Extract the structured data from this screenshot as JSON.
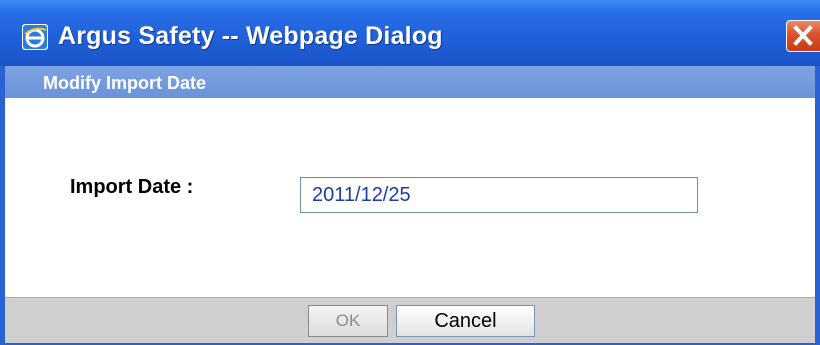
{
  "window": {
    "title": "Argus Safety -- Webpage Dialog",
    "icon": "internet-explorer-icon",
    "close_icon": "close-icon",
    "title_bar_color": "#1f5fd9",
    "close_button_color": "#d9532c"
  },
  "section": {
    "title": "Modify Import Date",
    "header_color": "#6b93d9"
  },
  "form": {
    "import_date_label": "Import Date :",
    "import_date_value": "2011/12/25"
  },
  "buttons": {
    "ok_label": "OK",
    "cancel_label": "Cancel"
  }
}
